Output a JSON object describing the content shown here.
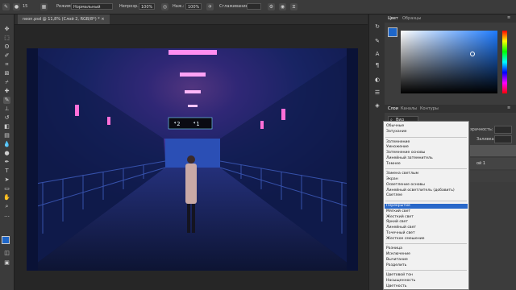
{
  "options_bar": {
    "mode_label": "Режим:",
    "mode_value": "Нормальный",
    "opacity_label": "Непрозр.:",
    "opacity_value": "100%",
    "flow_label": "Наж.:",
    "flow_value": "100%",
    "smoothing_label": "Сглаживание:",
    "brush_size": "15"
  },
  "document": {
    "tab_title": "neon.psd @ 11,8% (Слой 2, RGB/8*) *"
  },
  "color_panel": {
    "tab_color": "Цвет",
    "tab_swatches": "Образцы"
  },
  "layers_panel": {
    "tab_layers": "Слои",
    "tab_channels": "Каналы",
    "tab_paths": "Контуры",
    "filter_label": "Вид",
    "opacity_label": "зрачность:",
    "fill_label": "Заливка:",
    "layer_name": "ой 1"
  },
  "blend_menu": {
    "groups": [
      [
        "Обычные",
        "Затухание"
      ],
      [
        "Затемнение",
        "Умножение",
        "Затемнение основы",
        "Линейный затемнитель",
        "Темнее"
      ],
      [
        "Замена светлым",
        "Экран",
        "Осветление основы",
        "Линейный осветлитель (добавить)",
        "Светлее"
      ],
      [
        "Перекрытие",
        "Мягкий свет",
        "Жесткий свет",
        "Яркий свет",
        "Линейный свет",
        "Точечный свет",
        "Жесткое смешение"
      ],
      [
        "Разница",
        "Исключение",
        "Вычитание",
        "Разделить"
      ],
      [
        "Цветовой тон",
        "Насыщенность",
        "Цветность"
      ]
    ],
    "highlighted": "Перекрытие"
  },
  "photo_sign": {
    "left": "⁴2",
    "right": "⁴1"
  },
  "colors": {
    "foreground": "#1e66c8",
    "background": "#000000",
    "highlight": "#2968c9"
  }
}
